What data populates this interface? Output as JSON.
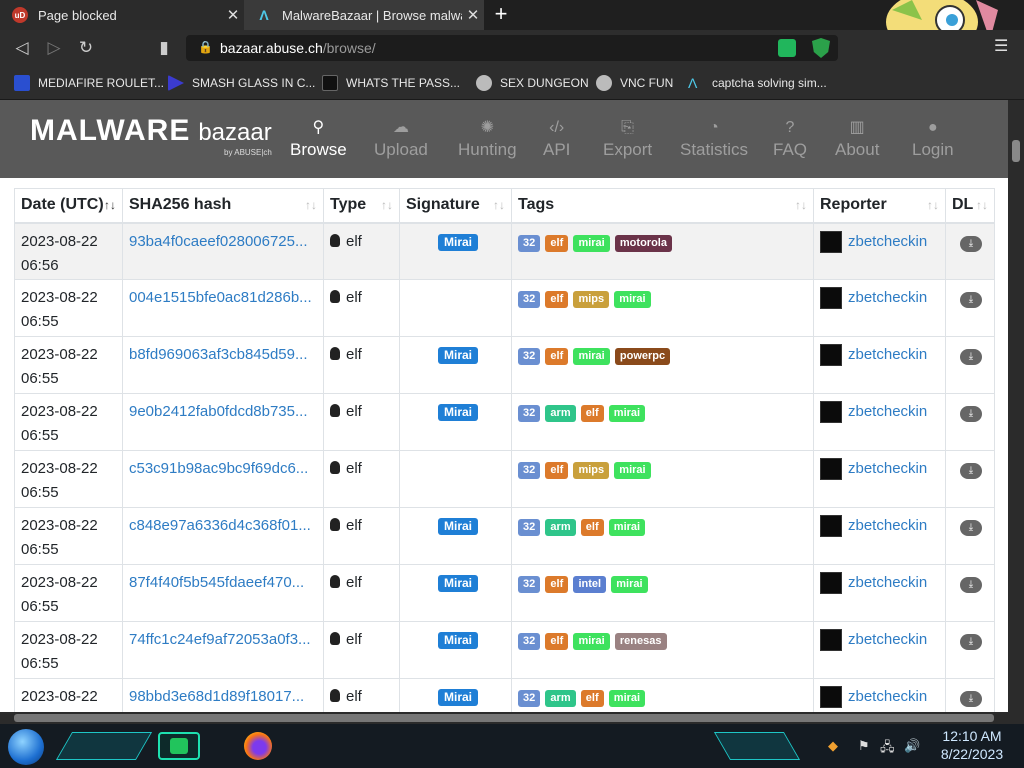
{
  "browser": {
    "tabs": [
      {
        "title": "Page blocked",
        "fav": "uD"
      },
      {
        "title": "MalwareBazaar | Browse malware s"
      }
    ],
    "url": {
      "host": "bazaar.abuse.ch",
      "path": "/browse/"
    },
    "bookmarks": [
      "MEDIAFIRE ROULET...",
      "SMASH GLASS IN C...",
      "WHATS THE PASS...",
      "SEX DUNGEON",
      "VNC FUN",
      "captcha solving sim..."
    ]
  },
  "site": {
    "logo_main": "MALWARE",
    "logo_sub": "bazaar",
    "logo_by": "by ABUSE|ch",
    "nav": [
      {
        "label": "Browse",
        "icon": "search-icon"
      },
      {
        "label": "Upload",
        "icon": "cloud-upload-icon"
      },
      {
        "label": "Hunting",
        "icon": "hunting-icon"
      },
      {
        "label": "API",
        "icon": "code-icon"
      },
      {
        "label": "Export",
        "icon": "export-icon"
      },
      {
        "label": "Statistics",
        "icon": "pie-chart-icon"
      },
      {
        "label": "FAQ",
        "icon": "question-icon"
      },
      {
        "label": "About",
        "icon": "building-icon"
      },
      {
        "label": "Login",
        "icon": "user-icon"
      }
    ]
  },
  "table": {
    "columns": [
      "Date (UTC)",
      "SHA256 hash",
      "Type",
      "Signature",
      "Tags",
      "Reporter",
      "DL"
    ],
    "rows": [
      {
        "date": "2023-08-22",
        "time": "06:56",
        "hash": "93ba4f0caeef028006725...",
        "type": "elf",
        "sig": "Mirai",
        "tags": [
          "32",
          "elf",
          "mirai",
          "motorola"
        ],
        "reporter": "zbetcheckin"
      },
      {
        "date": "2023-08-22",
        "time": "06:55",
        "hash": "004e1515bfe0ac81d286b...",
        "type": "elf",
        "sig": "",
        "tags": [
          "32",
          "elf",
          "mips",
          "mirai"
        ],
        "reporter": "zbetcheckin"
      },
      {
        "date": "2023-08-22",
        "time": "06:55",
        "hash": "b8fd969063af3cb845d59...",
        "type": "elf",
        "sig": "Mirai",
        "tags": [
          "32",
          "elf",
          "mirai",
          "powerpc"
        ],
        "reporter": "zbetcheckin"
      },
      {
        "date": "2023-08-22",
        "time": "06:55",
        "hash": "9e0b2412fab0fdcd8b735...",
        "type": "elf",
        "sig": "Mirai",
        "tags": [
          "32",
          "arm",
          "elf",
          "mirai"
        ],
        "reporter": "zbetcheckin"
      },
      {
        "date": "2023-08-22",
        "time": "06:55",
        "hash": "c53c91b98ac9bc9f69dc6...",
        "type": "elf",
        "sig": "",
        "tags": [
          "32",
          "elf",
          "mips",
          "mirai"
        ],
        "reporter": "zbetcheckin"
      },
      {
        "date": "2023-08-22",
        "time": "06:55",
        "hash": "c848e97a6336d4c368f01...",
        "type": "elf",
        "sig": "Mirai",
        "tags": [
          "32",
          "arm",
          "elf",
          "mirai"
        ],
        "reporter": "zbetcheckin"
      },
      {
        "date": "2023-08-22",
        "time": "06:55",
        "hash": "87f4f40f5b545fdaeef470...",
        "type": "elf",
        "sig": "Mirai",
        "tags": [
          "32",
          "elf",
          "intel",
          "mirai"
        ],
        "reporter": "zbetcheckin"
      },
      {
        "date": "2023-08-22",
        "time": "06:55",
        "hash": "74ffc1c24ef9af72053a0f3...",
        "type": "elf",
        "sig": "Mirai",
        "tags": [
          "32",
          "elf",
          "mirai",
          "renesas"
        ],
        "reporter": "zbetcheckin"
      },
      {
        "date": "2023-08-22",
        "time": "",
        "hash": "98bbd3e68d1d89f18017...",
        "type": "elf",
        "sig": "Mirai",
        "tags": [
          "32",
          "arm",
          "elf",
          "mirai"
        ],
        "reporter": "zbetcheckin"
      }
    ]
  },
  "taskbar": {
    "time": "12:10 AM",
    "date": "8/22/2023"
  },
  "colors": {
    "accent": "#2e7cc4",
    "header": "#595959",
    "sig": "#1f7fd6"
  }
}
